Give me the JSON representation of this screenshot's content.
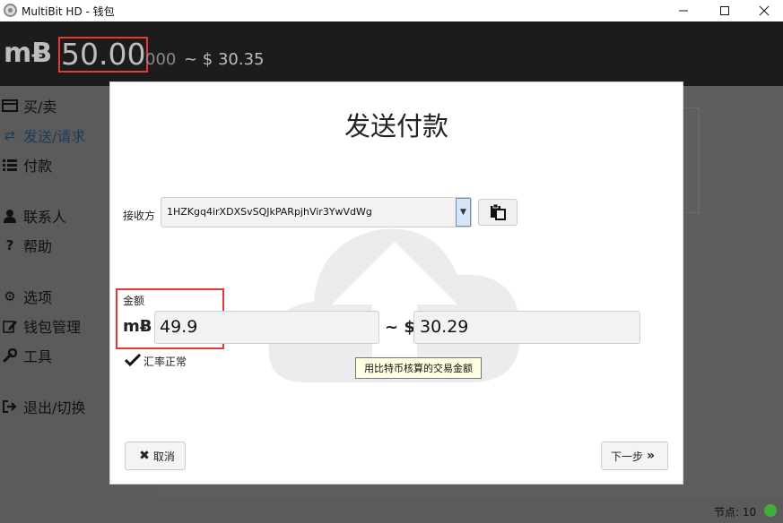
{
  "window": {
    "title": "MultiBit HD - 钱包",
    "minimize_icon": "minimize-icon",
    "maximize_icon": "maximize-icon",
    "close_icon": "close-icon"
  },
  "header": {
    "currency_symbol": "mɃ",
    "balance_main": "50.00",
    "balance_small": "000",
    "balance_fiat": "~ $ 30.35"
  },
  "sidebar": {
    "items": [
      {
        "label": "买/卖",
        "icon": "credit-card-icon"
      },
      {
        "label": "发送/请求",
        "icon": "exchange-icon"
      },
      {
        "label": "付款",
        "icon": "list-icon"
      },
      {
        "label": "联系人",
        "icon": "user-icon"
      },
      {
        "label": "帮助",
        "icon": "question-icon"
      },
      {
        "label": "选项",
        "icon": "gears-icon"
      },
      {
        "label": "钱包管理",
        "icon": "edit-icon"
      },
      {
        "label": "工具",
        "icon": "wrench-icon"
      },
      {
        "label": "退出/切换",
        "icon": "sign-out-icon"
      }
    ]
  },
  "dialog": {
    "title": "发送付款",
    "recipient_label": "接收方",
    "recipient_value": "1HZKgq4irXDXSvSQJkPARpjhVir3YwVdWg",
    "amount_label": "金额",
    "amount_symbol": "mɃ",
    "amount_value": "49.9",
    "approx_label": "~ $",
    "fiat_value": "30.29",
    "rate_status": "汇率正常",
    "tooltip": "用比特币核算的交易金额",
    "cancel_label": "取消",
    "next_label": "下一步"
  },
  "status": {
    "peers_label": "节点: 10",
    "peer_status_color": "#3fae3a"
  }
}
